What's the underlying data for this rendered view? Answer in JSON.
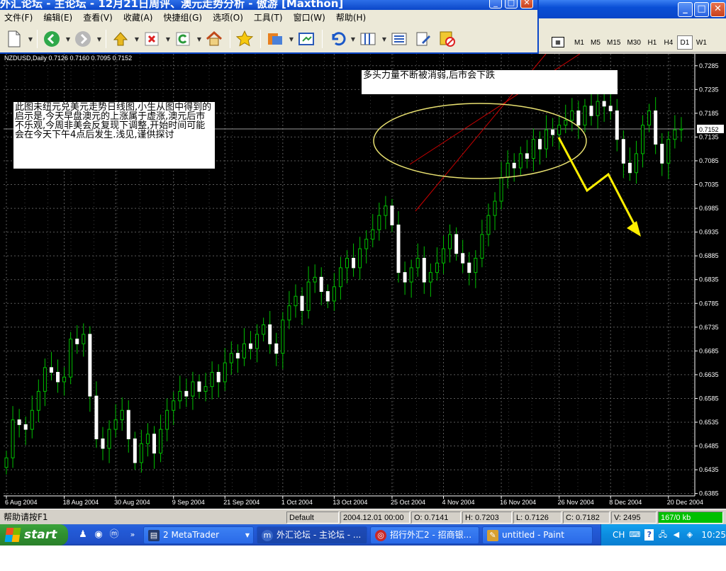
{
  "browser": {
    "title": "外汇论坛 - 主论坛 - 12月21日周评、澳元走势分析 - 傲游 [Maxthon]",
    "menu": [
      "文件(F)",
      "编辑(E)",
      "查看(V)",
      "收藏(A)",
      "快捷组(G)",
      "选项(O)",
      "工具(T)",
      "窗口(W)",
      "帮助(H)"
    ]
  },
  "metatrader": {
    "timeframes": [
      "M1",
      "M5",
      "M15",
      "M30",
      "H1",
      "H4",
      "D1",
      "W1"
    ],
    "active_timeframe": "D1"
  },
  "chart_data": {
    "type": "candlestick",
    "symbol_header": "NZDUSD,Daily  0.7126 0.7160 0.7095 0.7152",
    "price_ticks": [
      "0.7285",
      "0.7235",
      "0.7185",
      "0.7135",
      "0.7085",
      "0.7035",
      "0.6985",
      "0.6935",
      "0.6885",
      "0.6835",
      "0.6785",
      "0.6735",
      "0.6685",
      "0.6635",
      "0.6585",
      "0.6535",
      "0.6485",
      "0.6435",
      "0.6385"
    ],
    "price_range": [
      0.638,
      0.731
    ],
    "current_price": "0.7152",
    "date_ticks": [
      "6 Aug 2004",
      "18 Aug 2004",
      "30 Aug 2004",
      "9 Sep 2004",
      "21 Sep 2004",
      "1 Oct 2004",
      "13 Oct 2004",
      "25 Oct 2004",
      "4 Nov 2004",
      "16 Nov 2004",
      "26 Nov 2004",
      "8 Dec 2004",
      "20 Dec 2004"
    ],
    "closes": [
      0.646,
      0.654,
      0.653,
      0.652,
      0.656,
      0.66,
      0.665,
      0.664,
      0.662,
      0.663,
      0.671,
      0.67,
      0.672,
      0.659,
      0.65,
      0.648,
      0.652,
      0.654,
      0.656,
      0.65,
      0.645,
      0.649,
      0.651,
      0.647,
      0.652,
      0.656,
      0.658,
      0.66,
      0.659,
      0.662,
      0.66,
      0.661,
      0.664,
      0.662,
      0.666,
      0.668,
      0.667,
      0.67,
      0.669,
      0.672,
      0.674,
      0.67,
      0.668,
      0.675,
      0.678,
      0.68,
      0.677,
      0.683,
      0.684,
      0.681,
      0.679,
      0.682,
      0.686,
      0.688,
      0.686,
      0.69,
      0.692,
      0.694,
      0.697,
      0.699,
      0.695,
      0.685,
      0.683,
      0.686,
      0.688,
      0.683,
      0.685,
      0.687,
      0.69,
      0.693,
      0.689,
      0.687,
      0.685,
      0.688,
      0.693,
      0.697,
      0.7,
      0.705,
      0.708,
      0.707,
      0.71,
      0.709,
      0.713,
      0.711,
      0.715,
      0.714,
      0.716,
      0.717,
      0.719,
      0.716,
      0.72,
      0.718,
      0.721,
      0.72,
      0.719,
      0.713,
      0.708,
      0.706,
      0.71,
      0.716,
      0.719,
      0.712,
      0.708,
      0.713,
      0.715,
      0.7152
    ],
    "annotations": {
      "left_note": "此图未纽元兑美元走势日线图,小生从图中得到的启示是,今天早盘澳元的上涨属于虚涨,澳元后市不乐观,今周非美会反复现下调整,开始时间可能会在今天下午4点后发生.浅见,谨供探讨",
      "top_note": "多头力量不断被消弱,后市会下跌"
    }
  },
  "statusbar": {
    "help": "帮助请按F1",
    "profile": "Default",
    "datetime": "2004.12.01 00:00",
    "open": "O: 0.7141",
    "high": "H: 0.7203",
    "low": "L: 0.7126",
    "close": "C: 0.7182",
    "volume": "V: 2495",
    "traffic": "167/0 kb"
  },
  "taskbar": {
    "start": "start",
    "tasks": [
      "2 MetaTrader",
      "外汇论坛 - 主论坛 - ...",
      "招行外汇2 - 招商银...",
      "untitled - Paint"
    ],
    "tray_lang": "CH",
    "clock": "10:25"
  },
  "colors": {
    "chart_bg": "#000000",
    "candle": "#ffffff",
    "wick": "#00c000",
    "grid": "#5a5a5a",
    "channel": "#cc0000",
    "ellipse": "#e8e070",
    "arrow": "#ffee00",
    "taskbar": "#245edb",
    "start": "#2f8f2f",
    "traffic_bg": "#00c000"
  }
}
